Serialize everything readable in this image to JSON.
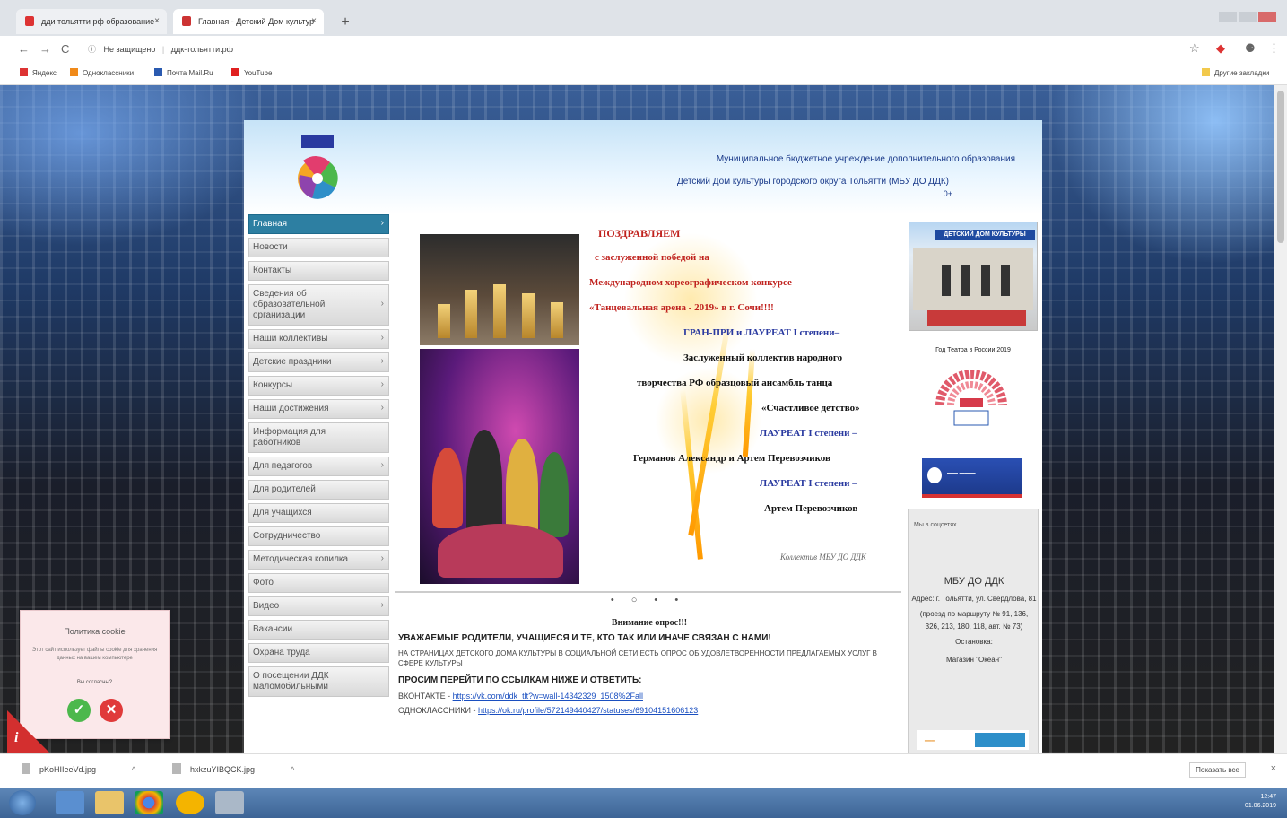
{
  "browser": {
    "tabs": [
      {
        "label": "дди тольятти рф образование",
        "close": "×"
      },
      {
        "label": "Главная - Детский Дом культур",
        "close": "×"
      }
    ],
    "new_tab": "+",
    "nav": {
      "back": "←",
      "forward": "→",
      "reload": "C"
    },
    "address": {
      "security": "Не защищено",
      "url": "ддк-тольятти.рф"
    },
    "icons": {
      "star": "☆",
      "account": "⚉",
      "menu": "⋮"
    },
    "bookmarks": [
      {
        "label": "Яндекс",
        "color": "#d33"
      },
      {
        "label": "Одноклассники",
        "color": "#f08a1a"
      },
      {
        "label": "Почта Mail.Ru",
        "color": "#2a5ab0"
      },
      {
        "label": "YouTube",
        "color": "#e02020"
      }
    ],
    "other_bookmarks": "Другие закладки"
  },
  "site": {
    "header": {
      "line1": "Муниципальное бюджетное учреждение дополнительного образования",
      "line2": "Детский Дом культуры городского округа Тольятти (МБУ ДО ДДК)",
      "age": "0+"
    },
    "menu": [
      {
        "label": "Главная",
        "arrow": "›",
        "active": true
      },
      {
        "label": "Новости",
        "arrow": ""
      },
      {
        "label": "Контакты",
        "arrow": ""
      },
      {
        "label": "Сведения об образовательной организации",
        "arrow": "›"
      },
      {
        "label": "Наши коллективы",
        "arrow": "›"
      },
      {
        "label": "Детские праздники",
        "arrow": "›"
      },
      {
        "label": "Конкурсы",
        "arrow": "›"
      },
      {
        "label": "Наши достижения",
        "arrow": "›"
      },
      {
        "label": "Информация для работников",
        "arrow": ""
      },
      {
        "label": "Для педагогов",
        "arrow": "›"
      },
      {
        "label": "Для родителей",
        "arrow": ""
      },
      {
        "label": "Для учащихся",
        "arrow": ""
      },
      {
        "label": "Сотрудничество",
        "arrow": ""
      },
      {
        "label": "Методическая копилка",
        "arrow": "›"
      },
      {
        "label": "Фото",
        "arrow": ""
      },
      {
        "label": "Видео",
        "arrow": "›"
      },
      {
        "label": "Вакансии",
        "arrow": ""
      },
      {
        "label": "Охрана труда",
        "arrow": ""
      },
      {
        "label": "О посещении ДДК маломобильными",
        "arrow": ""
      }
    ],
    "slide": {
      "lines": [
        "ПОЗДРАВЛЯЕМ",
        "с заслуженной победой на",
        "Международном хореографическом конкурсе",
        "«Танцевальная арена - 2019» в г. Сочи!!!!",
        "ГРАН-ПРИ и ЛАУРЕАТ I степени–",
        "Заслуженный коллектив народного",
        "творчества РФ образцовый ансамбль танца",
        "«Счастливое детство»",
        "ЛАУРЕАТ I степени –",
        "Германов Александр и Артем Перевозчиков",
        "ЛАУРЕАТ I степени –",
        "Артем Перевозчиков"
      ],
      "signature": "Коллектив МБУ ДО ДДК",
      "dots": "• ○ • •"
    },
    "poll": {
      "title": "Внимание опрос!!!",
      "heading": "УВАЖАЕМЫЕ РОДИТЕЛИ, УЧАЩИЕСЯ И ТЕ, КТО ТАК ИЛИ ИНАЧЕ СВЯЗАН С НАМИ!",
      "text": "НА СТРАНИЦАХ ДЕТСКОГО ДОМА КУЛЬТУРЫ В СОЦИАЛЬНОЙ СЕТИ ЕСТЬ ОПРОС ОБ УДОВЛЕТВОРЕННОСТИ ПРЕДЛАГАЕМЫХ УСЛУГ В СФЕРЕ КУЛЬТУРЫ",
      "call": "ПРОСИМ ПЕРЕЙТИ ПО ССЫЛКАМ НИЖЕ И ОТВЕТИТЬ:",
      "vk_label": "ВКОНТАКТЕ - ",
      "vk_url": "https://vk.com/ddk_tlt?w=wall-14342329_1508%2Fall",
      "ok_label": "ОДНОКЛАССНИКИ - ",
      "ok_url": "https://ok.ru/profile/572149440427/statuses/69104151606123"
    },
    "right": {
      "building_sign": "ДЕТСКИЙ ДОМ КУЛЬТУРЫ",
      "theatre_year": "Год Театра в России 2019",
      "socials": "Мы в соцсетях",
      "org": "МБУ ДО ДДК",
      "address": "Адрес: г. Тольятти, ул. Свердлова, 81",
      "route": "(проезд по маршруту № 91, 136, 326, 213, 180, 118, авт. № 73)",
      "stop_label": "Остановка:",
      "stop": "Магазин \"Океан\""
    },
    "cookie": {
      "title": "Политика cookie",
      "desc": "Этот сайт использует файлы cookie для хранения данных на вашем компьютере",
      "question": "Вы согласны?",
      "yes": "✓",
      "no": "✕"
    },
    "info_icon": "i"
  },
  "downloads": {
    "items": [
      {
        "name": "pKoHIIeeVd.jpg",
        "chev": "^"
      },
      {
        "name": "hxkzuYIBQCK.jpg",
        "chev": "^"
      }
    ],
    "show_all": "Показать все",
    "close": "×"
  },
  "taskbar": {
    "time": "12:47",
    "date": "01.06.2019"
  }
}
